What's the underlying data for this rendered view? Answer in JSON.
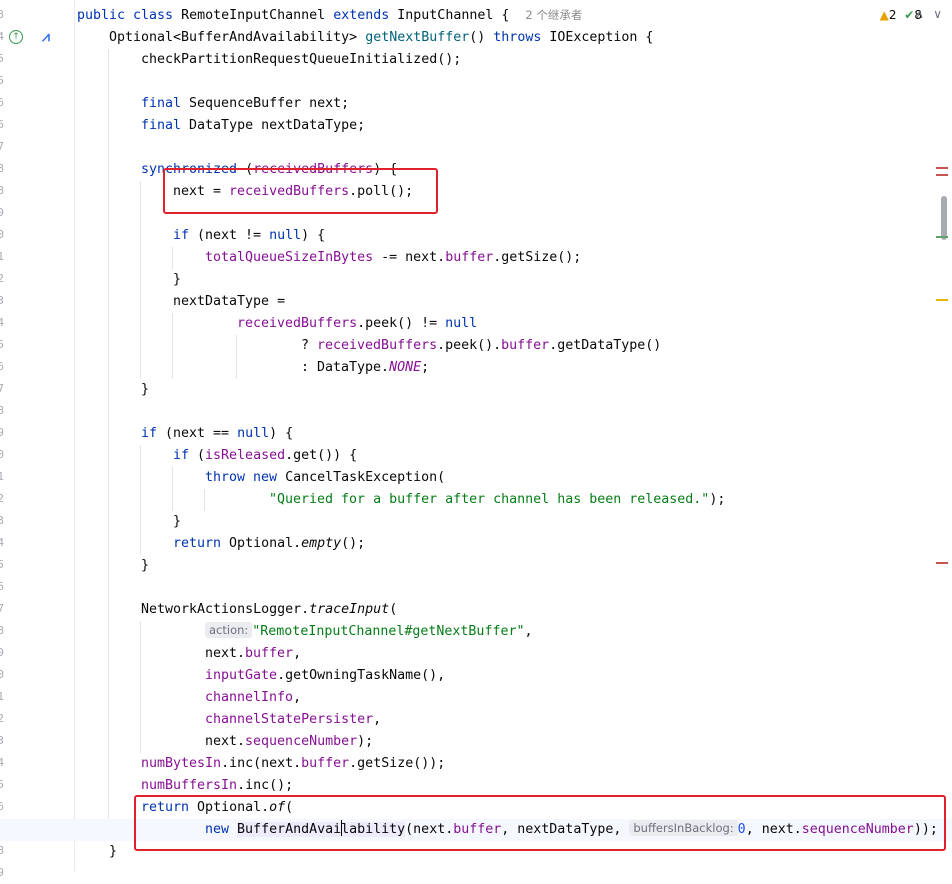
{
  "inspections": {
    "warnings": "2",
    "weak_warnings": "8"
  },
  "inlay_hints": {
    "inheritors": "2 个继承者",
    "action": "action:",
    "buffers_in_backlog": "buffersInBacklog:"
  },
  "code": {
    "class_kw": "public class",
    "class_name": "RemoteInputChannel",
    "extends_kw": "extends",
    "parent_class": "InputChannel {",
    "method_ret": "Optional<BufferAndAvailability> ",
    "method_name": "getNextBuffer",
    "method_paren": "() ",
    "throws_kw": "throws",
    "method_tail": " IOException {",
    "l3": "checkPartitionRequestQueueInitialized();",
    "final_kw": "final",
    "l5_rest": " SequenceBuffer next;",
    "l6_rest": " DataType nextDataType;",
    "sync_kw": "synchronized",
    "sync_field": "receivedBuffers",
    "l8_tail": ") {",
    "l9_a": "next = ",
    "l9_field": "receivedBuffers",
    "l9_b": ".poll();",
    "if_kw": "if",
    "null_kw": "null",
    "l11_a": " (next != ",
    "l11_b": ") {",
    "l12_field": "totalQueueSizeInBytes",
    "l12_a": " -= next.",
    "l12_field2": "buffer",
    "l12_b": ".getSize();",
    "brace_close": "}",
    "l14": "nextDataType =",
    "l15_field": "receivedBuffers",
    "l15_a": ".peek() != ",
    "l16_q": "? ",
    "l16_field": "receivedBuffers",
    "l16_a": ".peek().",
    "l16_field2": "buffer",
    "l16_b": ".getDataType()",
    "l17_a": ": DataType.",
    "l17_static": "NONE",
    "l17_b": ";",
    "l20_a": " (next == ",
    "l20_b": ") {",
    "l21_a": " (",
    "l21_fn": "isReleased",
    "l21_b": ".get()) {",
    "throw_kw": "throw",
    "new_kw": "new",
    "l22_rest": " CancelTaskException(",
    "l23_str": "\"Queried for a buffer after channel has been released.\"",
    "l23_tail": ");",
    "return_kw": "return",
    "l25_a": " Optional.",
    "l25_it": "empty",
    "l25_b": "();",
    "l28_a": "NetworkActionsLogger.",
    "l28_it": "traceInput",
    "l28_b": "(",
    "l29_str": "\"RemoteInputChannel#getNextBuffer\"",
    "l29_b": ",",
    "l30_a": "next.",
    "l30_field": "buffer",
    "l30_b": ",",
    "l31_field": "inputGate",
    "l31_b": ".getOwningTaskName(),",
    "l32_field": "channelInfo",
    "l32_b": ",",
    "l33_field": "channelStatePersister",
    "l33_b": ",",
    "l34_a": "next.",
    "l34_field": "sequenceNumber",
    "l34_b": ");",
    "l35_field": "numBytesIn",
    "l35_a": ".inc(next.",
    "l35_field2": "buffer",
    "l35_b": ".getSize());",
    "l36_field": "numBuffersIn",
    "l36_b": ".inc();",
    "l37_a": " Optional.",
    "l37_it": "of",
    "l37_b": "(",
    "l38_cls_a": "BufferAndAvai",
    "l38_cls_b": "lability",
    "l38_a": "(next.",
    "l38_field": "buffer",
    "l38_b": ", nextDataType, ",
    "l38_num": "0",
    "l38_c": ", next.",
    "l38_field2": "sequenceNumber",
    "l38_d": "));",
    "l39": "}"
  },
  "line_numbers": [
    "3",
    "4",
    "5",
    "5",
    "6",
    "6",
    "7",
    "8",
    "8",
    "9",
    "0",
    "1",
    "2",
    "3",
    "4",
    "5",
    "6",
    "7",
    "8",
    "9",
    "0",
    "1",
    "2",
    "3",
    "4",
    "5",
    "6",
    "7",
    "8",
    "9",
    "0",
    "1",
    "2",
    "3",
    "4",
    "5",
    "6",
    "7",
    "8",
    "9"
  ]
}
